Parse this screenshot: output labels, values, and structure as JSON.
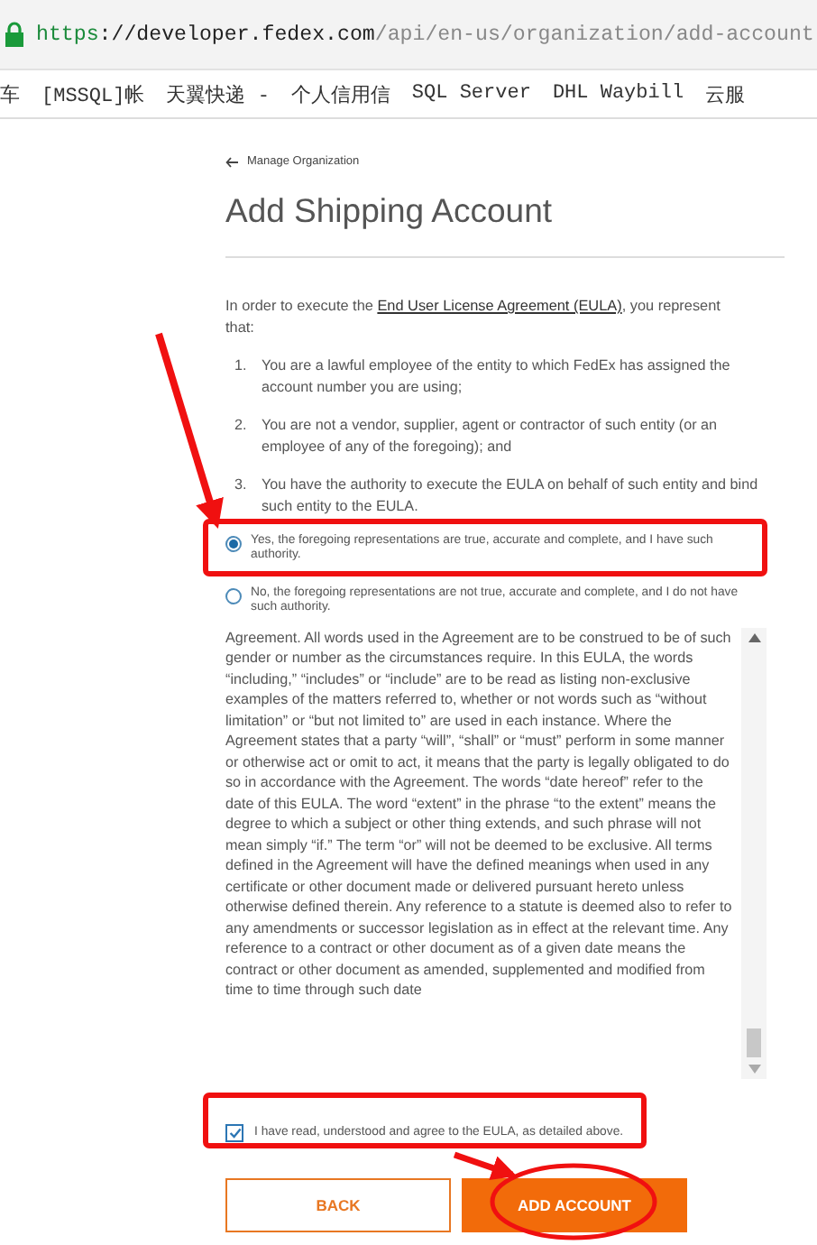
{
  "browser": {
    "address": {
      "scheme": "https",
      "rest": "://developer.fedex.com",
      "path": "/api/en-us/organization/add-account"
    },
    "bookmarks": [
      "车",
      "[MSSQL]帐",
      "天翼快递 -",
      "个人信用信",
      "SQL Server",
      "DHL Waybill",
      "云服"
    ]
  },
  "back_link": "Manage Organization",
  "title": "Add Shipping Account",
  "intro": {
    "before": "In order to execute the ",
    "link": "End User License Agreement (EULA)",
    "after": ", you represent that:"
  },
  "representations": [
    {
      "number": "1.",
      "text": "You are a lawful employee of the entity to which FedEx has assigned the account number you are using;"
    },
    {
      "number": "2.",
      "text": "You are not a vendor, supplier, agent or contractor of such entity (or an employee of any of the foregoing); and"
    },
    {
      "number": "3.",
      "text": "You have the authority to execute the EULA on behalf of such entity and bind such entity to the EULA."
    }
  ],
  "choices": [
    {
      "label": "Yes, the foregoing representations are true, accurate and complete, and I have such authority.",
      "selected": true
    },
    {
      "label": "No, the foregoing representations are not true, accurate and complete, and I do not have such authority.",
      "selected": false
    }
  ],
  "eula_text": "Agreement. All words used in the Agreement are to be construed to be of such gender or number as the circumstances require. In this EULA, the words “including,” “includes” or “include” are to be read as listing non-exclusive examples of the matters referred to, whether or not words such as “without limitation” or “but not limited to” are used in each instance. Where the Agreement states that a party “will”, “shall” or “must” perform in some manner or otherwise act or omit to act, it means that the party is legally obligated to do so in accordance with the Agreement. The words “date hereof” refer to the date of this EULA. The word “extent” in the phrase “to the extent” means the degree to which a subject or other thing extends, and such phrase will not mean simply “if.” The term “or” will not be deemed to be exclusive. All terms defined in the Agreement will have the defined meanings when used in any certificate or other document made or delivered pursuant hereto unless otherwise defined therein. Any reference to a statute is deemed also to refer to any amendments or successor legislation as in effect at the relevant time.  Any reference to a contract or other document as of a given date means the contract or other document as amended, supplemented and modified from time to time through such date",
  "agreement": {
    "label": "I have read, understood and agree to the EULA, as detailed above.",
    "checked": true
  },
  "buttons": [
    {
      "label": "BACK",
      "kind": "secondary"
    },
    {
      "label": "ADD ACCOUNT",
      "kind": "primary"
    }
  ]
}
